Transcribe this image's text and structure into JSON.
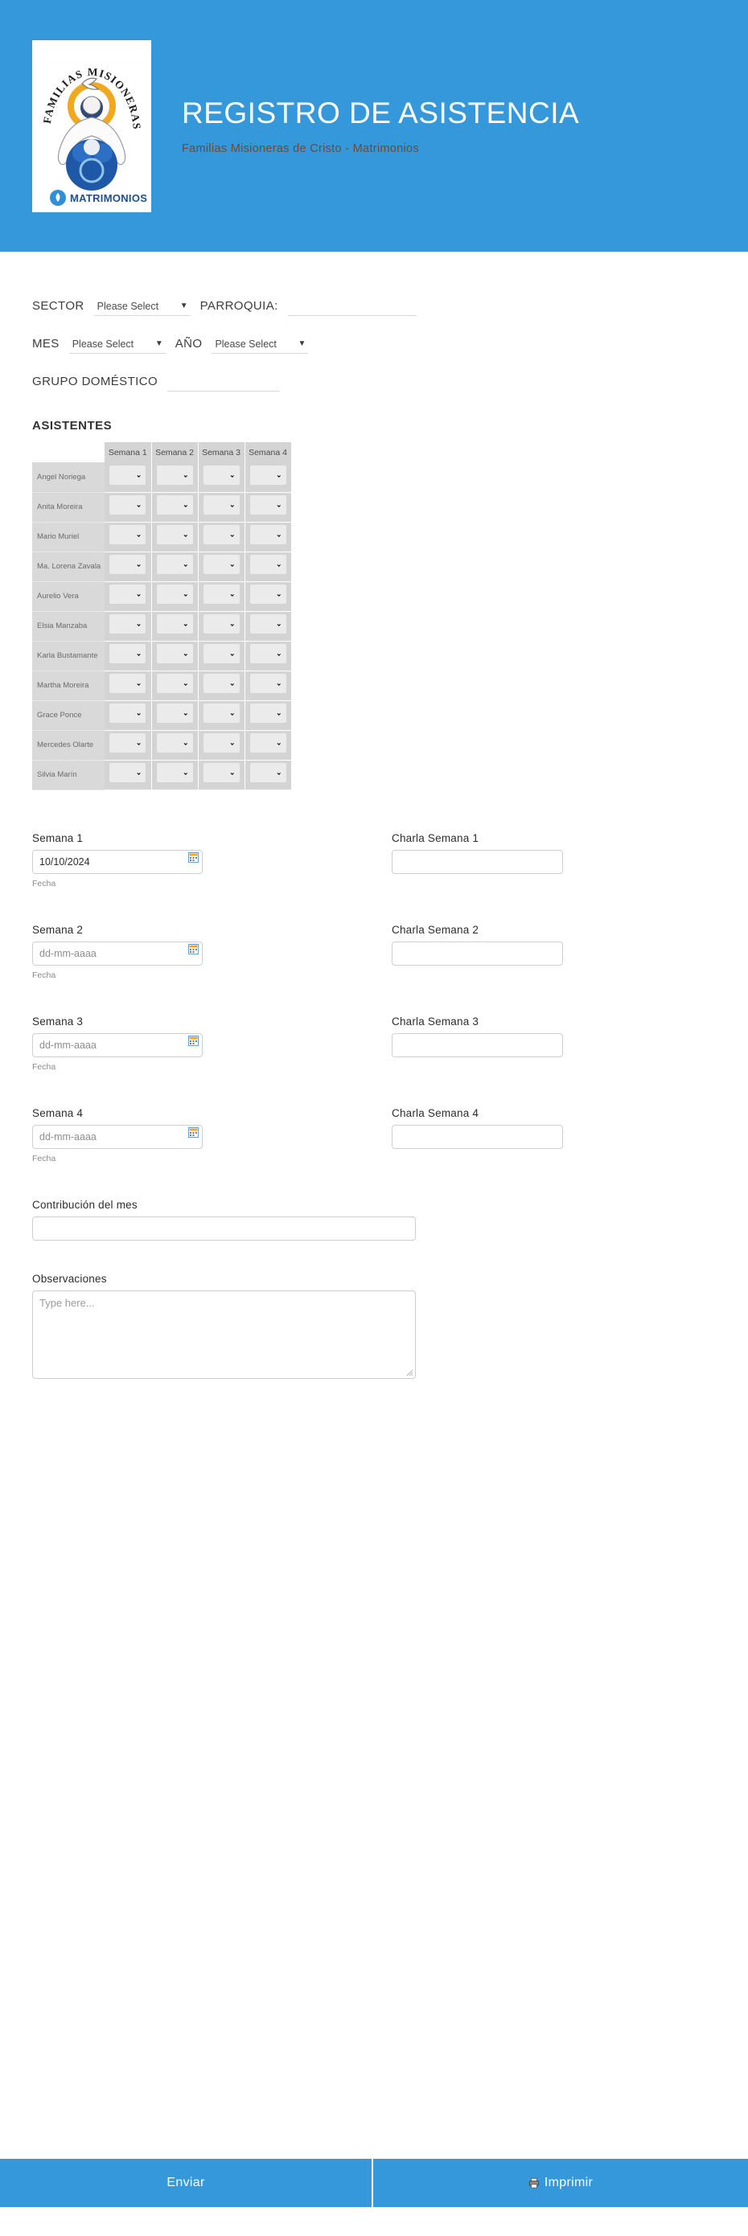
{
  "header": {
    "title": "REGISTRO  DE ASISTENCIA",
    "subtitle": "Familias  Misioneras de Cristo -  Matrimonios",
    "logo_arc_text": "FAMILIAS MISIONERAS DE CRISTO",
    "logo_bottom_text": "MATRIMONIOS",
    "background_color": "#3498db"
  },
  "meta": {
    "sector_label": "SECTOR",
    "sector_value": "Please Select",
    "parroquia_label": "PARROQUIA:",
    "parroquia_value": "",
    "mes_label": "MES",
    "mes_value": "Please Select",
    "anio_label": "AÑO",
    "anio_value": "Please Select",
    "grupo_label": "GRUPO  DOMÉSTICO",
    "grupo_value": ""
  },
  "attendance": {
    "section_title": "ASISTENTES",
    "columns": [
      "Semana 1",
      "Semana 2",
      "Semana 3",
      "Semana 4"
    ],
    "rows": [
      {
        "name": "Angel  Noriega",
        "values": [
          "",
          "",
          "",
          ""
        ]
      },
      {
        "name": "Anita  Moreira",
        "values": [
          "",
          "",
          "",
          ""
        ]
      },
      {
        "name": "Mario  Muriel",
        "values": [
          "",
          "",
          "",
          ""
        ]
      },
      {
        "name": "Ma.  Lorena Zavala",
        "values": [
          "",
          "",
          "",
          ""
        ]
      },
      {
        "name": "Aurelio Vera",
        "values": [
          "",
          "",
          "",
          ""
        ]
      },
      {
        "name": "Elsia  Manzaba",
        "values": [
          "",
          "",
          "",
          ""
        ]
      },
      {
        "name": "Karla  Bustamante",
        "values": [
          "",
          "",
          "",
          ""
        ]
      },
      {
        "name": "Martha  Moreira",
        "values": [
          "",
          "",
          "",
          ""
        ]
      },
      {
        "name": "Grace  Ponce",
        "values": [
          "",
          "",
          "",
          ""
        ]
      },
      {
        "name": "Mercedes Olarte",
        "values": [
          "",
          "",
          "",
          ""
        ]
      },
      {
        "name": "Silvia  Marín",
        "values": [
          "",
          "",
          "",
          ""
        ]
      }
    ]
  },
  "weeks": [
    {
      "date_label": "Semana 1",
      "date_value": "10/10/2024",
      "date_placeholder": "dd-mm-aaaa",
      "helper": "Fecha",
      "charla_label": "Charla Semana 1",
      "charla_value": ""
    },
    {
      "date_label": "Semana 2",
      "date_value": "",
      "date_placeholder": "dd-mm-aaaa",
      "helper": "Fecha",
      "charla_label": "Charla Semana 2",
      "charla_value": ""
    },
    {
      "date_label": "Semana 3",
      "date_value": "",
      "date_placeholder": "dd-mm-aaaa",
      "helper": "Fecha",
      "charla_label": "Charla Semana 3",
      "charla_value": ""
    },
    {
      "date_label": "Semana 4",
      "date_value": "",
      "date_placeholder": "dd-mm-aaaa",
      "helper": "Fecha",
      "charla_label": "Charla Semana 4",
      "charla_value": ""
    }
  ],
  "contribucion": {
    "label": "Contribución del mes",
    "value": "",
    "placeholder": ""
  },
  "observaciones": {
    "label": "Observaciones",
    "value": "",
    "placeholder": "Type here..."
  },
  "footer": {
    "submit_label": "Enviar",
    "print_label": "Imprimir",
    "button_color": "#3498db"
  }
}
